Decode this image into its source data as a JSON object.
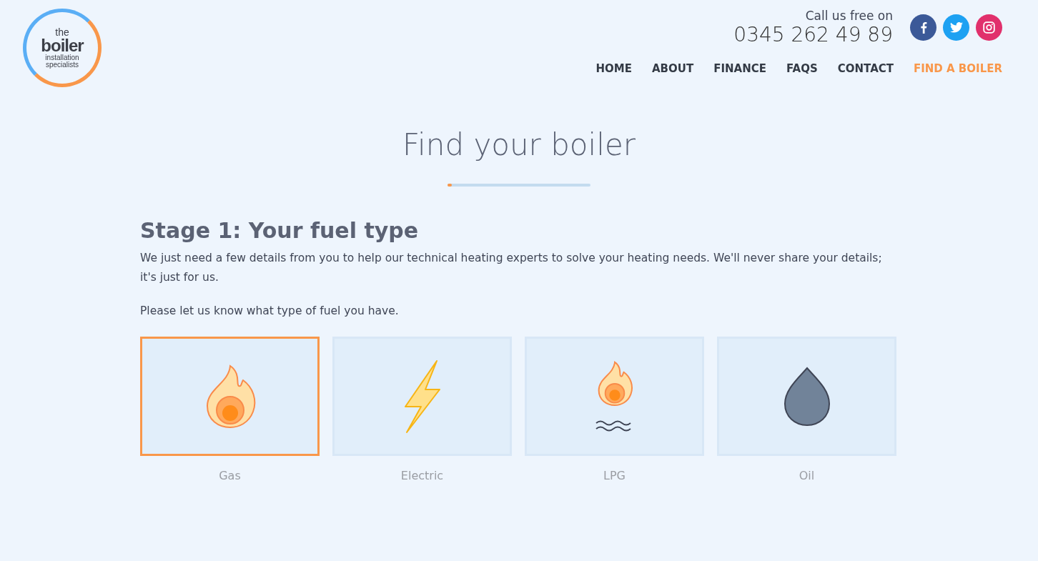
{
  "logo": {
    "lines": [
      "the",
      "boiler",
      "installation",
      "specialists"
    ]
  },
  "header": {
    "call_label": "Call us free on",
    "phone": "0345 262 49 89"
  },
  "social": [
    {
      "kind": "facebook",
      "color": "#3b5998"
    },
    {
      "kind": "twitter",
      "color": "#1da1f2"
    },
    {
      "kind": "instagram",
      "color": "#e1306c"
    }
  ],
  "nav": [
    {
      "label": "HOME",
      "selected": false
    },
    {
      "label": "ABOUT",
      "selected": false
    },
    {
      "label": "FINANCE",
      "selected": false
    },
    {
      "label": "FAQS",
      "selected": false
    },
    {
      "label": "CONTACT",
      "selected": false
    },
    {
      "label": "FIND A BOILER",
      "selected": true
    }
  ],
  "page_title": "Find your boiler",
  "progress": {
    "level": 0.03
  },
  "stage": {
    "heading": "Stage 1: Your fuel type",
    "intro": "We just need a few details from you to help our technical heating experts to solve your heating needs. We'll never share your details; it's just for us.",
    "prompt": "Please let us know what type of fuel you have."
  },
  "fuels": [
    {
      "kind": "gas",
      "label": "Gas",
      "selected": true
    },
    {
      "kind": "electric",
      "label": "Electric",
      "selected": false
    },
    {
      "kind": "lpg",
      "label": "LPG",
      "selected": false
    },
    {
      "kind": "oil",
      "label": "Oil",
      "selected": false
    }
  ]
}
